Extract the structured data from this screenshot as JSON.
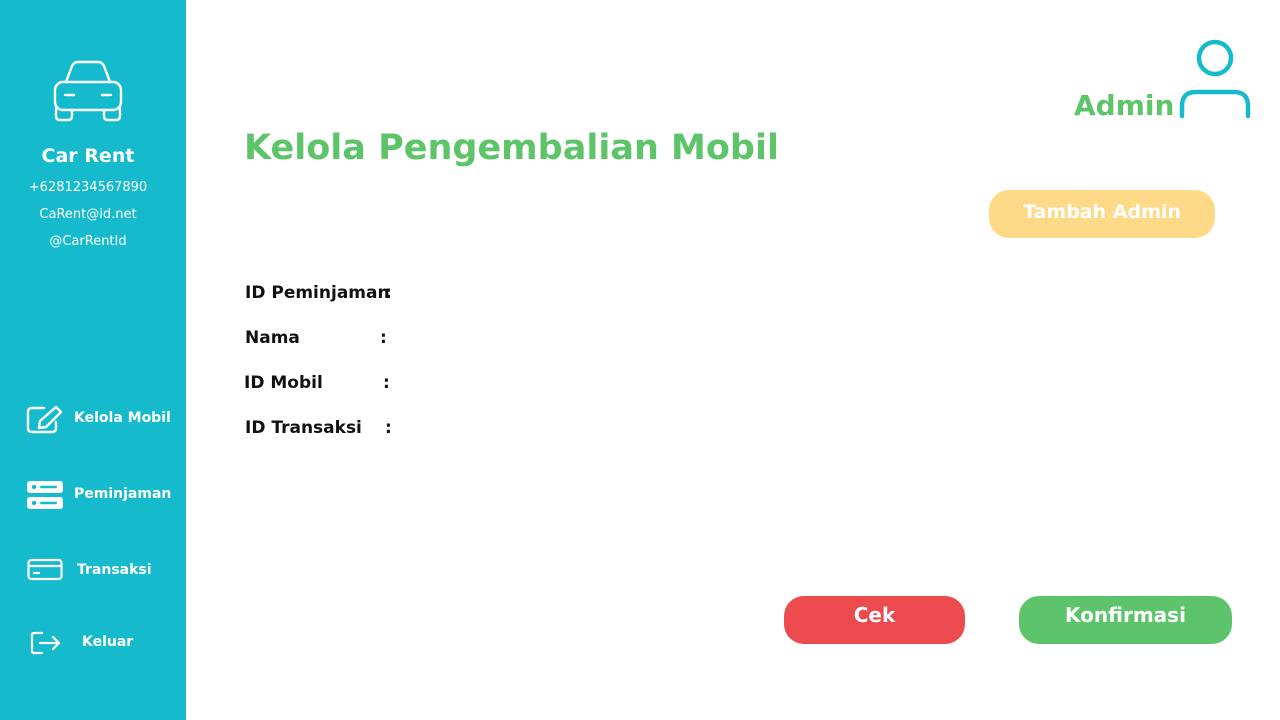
{
  "sidebar": {
    "logo_icon": "car-icon",
    "brand_name": "Car Rent",
    "phone": "+6281234567890",
    "email": "CaRent@id.net",
    "social": "@CarRentId",
    "items": [
      {
        "label": "Kelola Mobil",
        "icon": "edit-icon"
      },
      {
        "label": "Peminjaman",
        "icon": "server-icon"
      },
      {
        "label": "Transaksi",
        "icon": "credit-card-icon"
      },
      {
        "label": "Keluar",
        "icon": "logout-icon"
      }
    ]
  },
  "header": {
    "user_label": "Admin",
    "user_icon": "user-icon"
  },
  "main": {
    "title": "Kelola Pengembalian Mobil",
    "add_admin_button": "Tambah Admin",
    "fields": [
      {
        "label": "ID Peminjaman",
        "colon": ":"
      },
      {
        "label": "Nama",
        "colon": ":"
      },
      {
        "label": "ID Mobil",
        "colon": ":"
      },
      {
        "label": "ID Transaksi",
        "colon": ":"
      }
    ],
    "check_button": "Cek",
    "confirm_button": "Konfirmasi"
  },
  "colors": {
    "sidebar": "#16bacd",
    "accent_green": "#5ec469",
    "button_yellow": "#fed987",
    "button_red": "#eb4a4e",
    "button_green": "#5ec46c"
  }
}
